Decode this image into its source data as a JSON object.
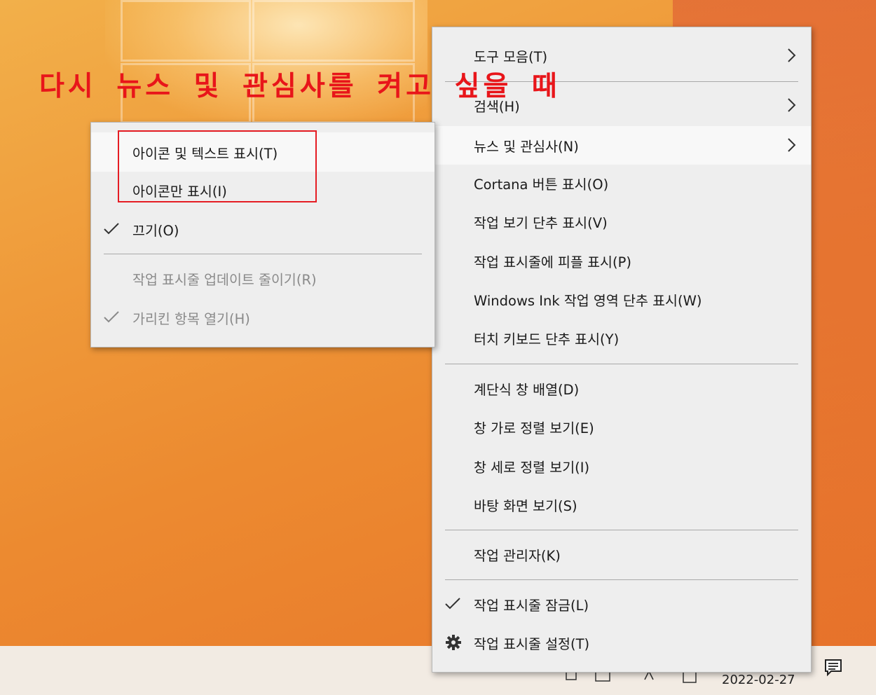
{
  "annotation": {
    "text": "다시 뉴스 및 관심사를 켜고 싶을 때",
    "color": "#e8151a"
  },
  "main_menu": {
    "items": [
      {
        "label": "도구 모음(T)",
        "has_submenu": true
      },
      {
        "label": "검색(H)",
        "has_submenu": true
      },
      {
        "label": "뉴스 및 관심사(N)",
        "has_submenu": true,
        "hovered": true
      },
      {
        "label": "Cortana 버튼 표시(O)"
      },
      {
        "label": "작업 보기 단추 표시(V)"
      },
      {
        "label": "작업 표시줄에 피플 표시(P)"
      },
      {
        "label": "Windows Ink 작업 영역 단추 표시(W)"
      },
      {
        "label": "터치 키보드 단추 표시(Y)"
      },
      {
        "label": "계단식 창 배열(D)"
      },
      {
        "label": "창 가로 정렬 보기(E)"
      },
      {
        "label": "창 세로 정렬 보기(I)"
      },
      {
        "label": "바탕 화면 보기(S)"
      },
      {
        "label": "작업 관리자(K)"
      },
      {
        "label": "작업 표시줄 잠금(L)",
        "checked": true
      },
      {
        "label": "작업 표시줄 설정(T)",
        "icon": "gear-icon"
      }
    ]
  },
  "sub_menu": {
    "items": [
      {
        "label": "아이콘 및 텍스트 표시(T)",
        "hovered": true
      },
      {
        "label": "아이콘만 표시(I)"
      },
      {
        "label": "끄기(O)",
        "checked": true
      },
      {
        "label": "작업 표시줄 업데이트 줄이기(R)",
        "disabled": true
      },
      {
        "label": "가리킨 항목 열기(H)",
        "disabled": true,
        "checked": true
      }
    ]
  },
  "taskbar": {
    "date": "2022-02-27",
    "notification_icon": "notification-icon"
  },
  "colors": {
    "highlight_box": "#e51c23",
    "menu_bg": "#eeeeee"
  }
}
